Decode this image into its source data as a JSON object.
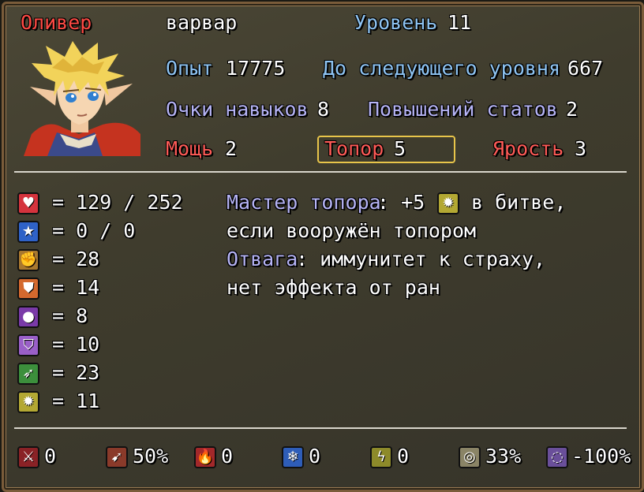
{
  "header": {
    "name": "Оливер",
    "class": "варвар",
    "level_label": "Уровень",
    "level_value": "11",
    "exp_label": "Опыт",
    "exp_value": "17775",
    "next_label": "До следующего уровня",
    "next_value": "667",
    "skill_points_label": "Очки навыков",
    "skill_points_value": "8",
    "stat_ups_label": "Повышений статов",
    "stat_ups_value": "2",
    "might_label": "Мощь",
    "might_value": "2",
    "axe_label": "Топор",
    "axe_value": "5",
    "rage_label": "Ярость",
    "rage_value": "3"
  },
  "stats": [
    {
      "icon": "heart-icon",
      "text": "= 129 / 252"
    },
    {
      "icon": "mana-star-icon",
      "text": "= 0 / 0"
    },
    {
      "icon": "attack-fist-icon",
      "text": "= 28"
    },
    {
      "icon": "defense-shield-icon",
      "text": "= 14"
    },
    {
      "icon": "magic-orb-icon",
      "text": "= 8"
    },
    {
      "icon": "magic-shield-icon",
      "text": "= 10"
    },
    {
      "icon": "agility-runner-icon",
      "text": "= 23"
    },
    {
      "icon": "luck-gear-icon",
      "text": "= 11"
    }
  ],
  "traits": {
    "axe_master_name": "Мастер топора",
    "axe_master_rest": ": +5",
    "axe_master_tail": "в битве,",
    "axe_master_line2": "если вооружён топором",
    "courage_name": "Отвага",
    "courage_rest": ": иммунитет к страху,",
    "courage_line2": "нет эффекта от ран"
  },
  "resistances": [
    {
      "icon": "pierce-icon",
      "value": "0"
    },
    {
      "icon": "bow-icon",
      "value": "50%"
    },
    {
      "icon": "fire-icon",
      "value": "0"
    },
    {
      "icon": "ice-icon",
      "value": "0"
    },
    {
      "icon": "lightning-icon",
      "value": "0"
    },
    {
      "icon": "earth-icon",
      "value": "33%"
    },
    {
      "icon": "void-icon",
      "value": "-100%"
    }
  ]
}
